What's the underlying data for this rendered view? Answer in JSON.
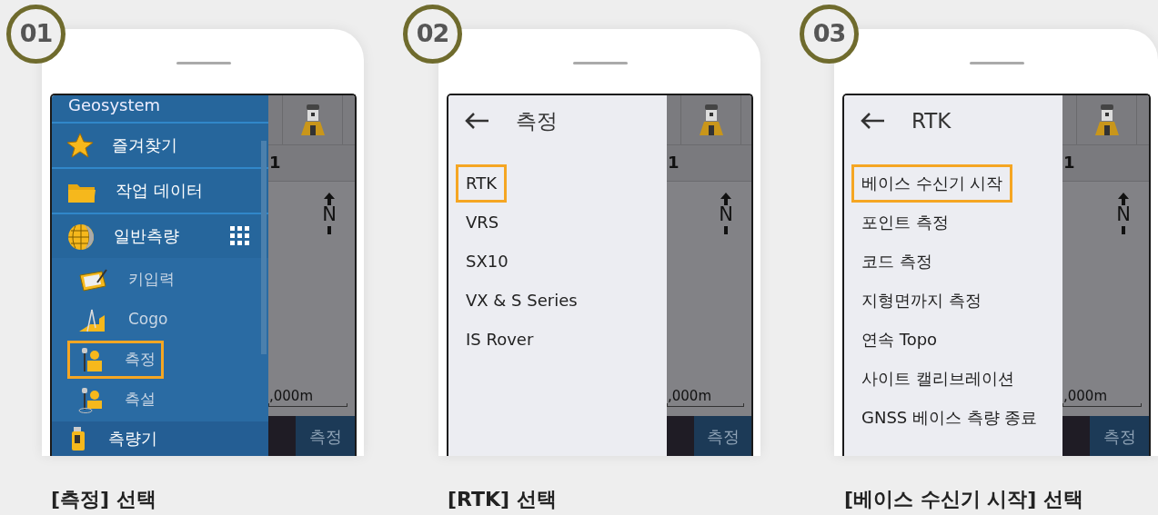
{
  "steps": [
    {
      "number": "01",
      "menu": {
        "kind": "drawer",
        "header": "Geosystem",
        "items": [
          {
            "label": "즐겨찾기",
            "kind": "star"
          },
          {
            "label": "작업 데이터",
            "kind": "folder"
          },
          {
            "label": "일반측량",
            "kind": "globe",
            "children": [
              {
                "label": "키입력",
                "kind": "notepad",
                "selected": false
              },
              {
                "label": "Cogo",
                "kind": "setsquare",
                "selected": false
              },
              {
                "label": "측정",
                "kind": "surveyor",
                "selected": true
              },
              {
                "label": "측설",
                "kind": "stakeout",
                "selected": false
              }
            ]
          },
          {
            "label": "측량기",
            "kind": "instrument"
          }
        ]
      },
      "map": {
        "row_label": "1",
        "north": "N",
        "scale": ",000m",
        "action": "측정"
      },
      "caption": "[측정] 선택"
    },
    {
      "number": "02",
      "menu": {
        "kind": "list",
        "title": "측정",
        "items": [
          {
            "label": "RTK",
            "selected": true
          },
          {
            "label": "VRS",
            "selected": false
          },
          {
            "label": "SX10",
            "selected": false
          },
          {
            "label": "VX & S Series",
            "selected": false
          },
          {
            "label": "IS Rover",
            "selected": false
          }
        ]
      },
      "map": {
        "row_label": "1",
        "north": "N",
        "scale": ",000m",
        "action": "측정"
      },
      "caption": "[RTK] 선택"
    },
    {
      "number": "03",
      "menu": {
        "kind": "list",
        "title": "RTK",
        "items": [
          {
            "label": "베이스 수신기 시작",
            "selected": true
          },
          {
            "label": "포인트 측정",
            "selected": false
          },
          {
            "label": "코드 측정",
            "selected": false
          },
          {
            "label": "지형면까지 측정",
            "selected": false
          },
          {
            "label": "연속 Topo",
            "selected": false
          },
          {
            "label": "사이트 캘리브레이션",
            "selected": false
          },
          {
            "label": "GNSS 베이스 측량 종료",
            "selected": false
          }
        ]
      },
      "map": {
        "row_label": "1",
        "north": "N",
        "scale": ",000m",
        "action": "측정"
      },
      "caption": "[베이스 수신기 시작] 선택"
    }
  ]
}
